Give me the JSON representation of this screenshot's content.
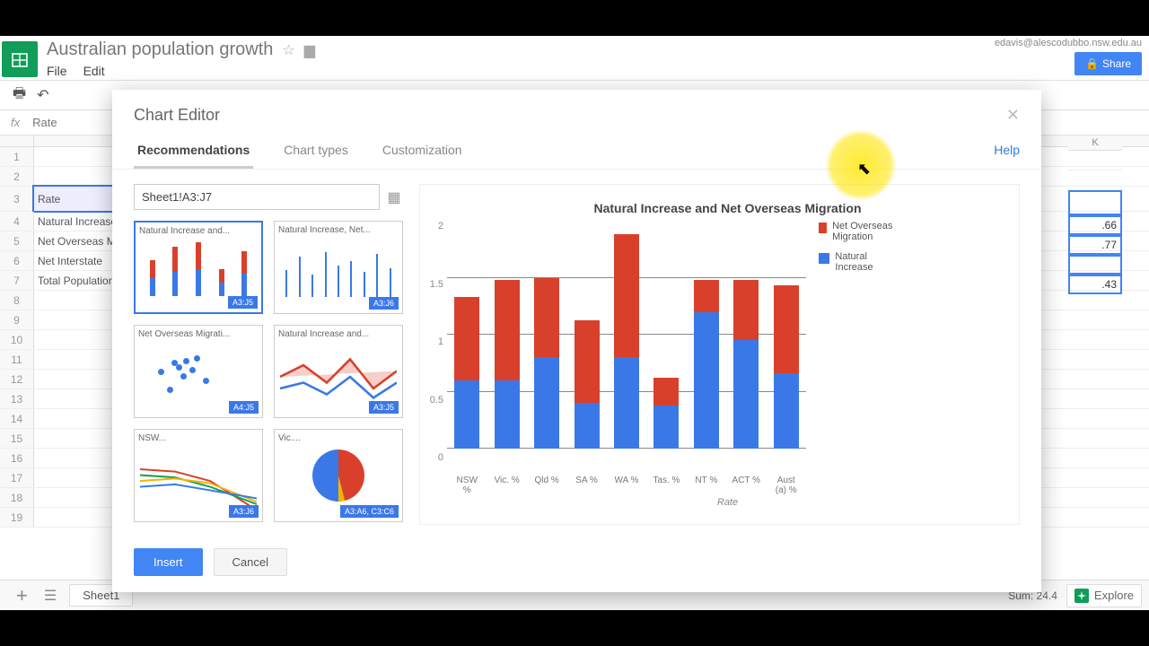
{
  "header": {
    "doc_title": "Australian population growth",
    "menu": [
      "File",
      "Edit"
    ],
    "user_email": "edavis@alescodubbo.nsw.edu.au",
    "share_label": "Share"
  },
  "formula_bar": {
    "fx": "fx",
    "value": "Rate"
  },
  "sheet_col": "K",
  "sheet_rows": {
    "r1": "",
    "r2": "",
    "r3": "Rate",
    "r4": "Natural Increase",
    "r5": "Net Overseas Migration",
    "r6": "Net Interstate",
    "r7": "Total Population"
  },
  "k_values": {
    "k4": ".66",
    "k5": ".77",
    "k7": ".43"
  },
  "row_numbers": [
    1,
    2,
    3,
    4,
    5,
    6,
    7,
    8,
    9,
    10,
    11,
    12,
    13,
    14,
    15,
    16,
    17,
    18,
    19
  ],
  "bottombar": {
    "sheet_tab": "Sheet1",
    "sum": "Sum: 24.4",
    "explore": "Explore"
  },
  "modal": {
    "title": "Chart Editor",
    "tabs": {
      "rec": "Recommendations",
      "types": "Chart types",
      "custom": "Customization"
    },
    "help": "Help",
    "range": "Sheet1!A3:J7",
    "thumbs": [
      {
        "label": "Natural Increase and...",
        "badge": "A3:J5"
      },
      {
        "label": "Natural Increase, Net...",
        "badge": "A3:J6"
      },
      {
        "label": "Net Overseas Migrati...",
        "badge": "A4:J5"
      },
      {
        "label": "Natural Increase and...",
        "badge": "A3:J5"
      },
      {
        "label": "NSW...",
        "badge": "A3:J6"
      },
      {
        "label": "Vic....",
        "badge": "A3:A6, C3:C6"
      }
    ],
    "insert": "Insert",
    "cancel": "Cancel"
  },
  "chart_data": {
    "type": "bar",
    "title": "Natural Increase and Net Overseas Migration",
    "xlabel": "Rate",
    "ylabel": "",
    "ylim": [
      0,
      2
    ],
    "yticks": [
      0,
      0.5,
      1,
      1.5,
      2
    ],
    "categories": [
      "NSW %",
      "Vic. %",
      "Qld %",
      "SA %",
      "WA %",
      "Tas. %",
      "NT %",
      "ACT %",
      "Aust (a) %"
    ],
    "series": [
      {
        "name": "Net Overseas Migration",
        "color": "#d9402b",
        "values": [
          0.73,
          0.88,
          0.7,
          0.73,
          1.08,
          0.24,
          0.28,
          0.53,
          0.77
        ]
      },
      {
        "name": "Natural Increase",
        "color": "#3b78e7",
        "values": [
          0.6,
          0.6,
          0.8,
          0.4,
          0.8,
          0.38,
          1.2,
          0.95,
          0.66
        ]
      }
    ]
  }
}
